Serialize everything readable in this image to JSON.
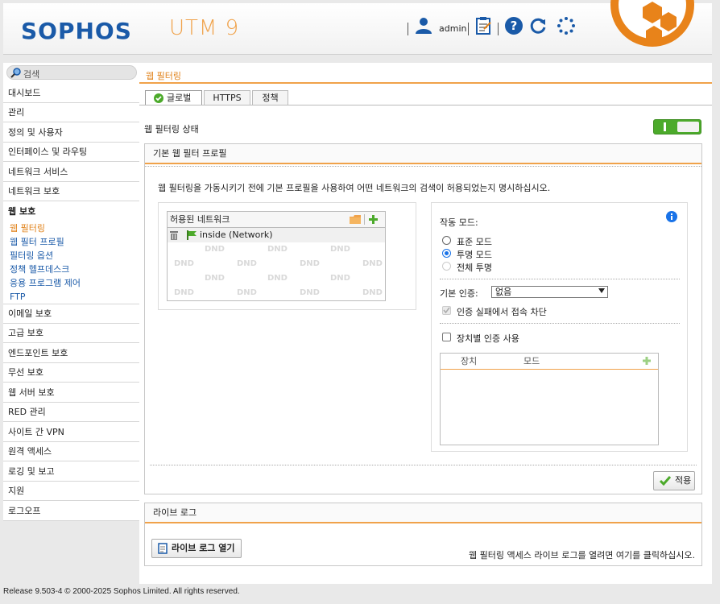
{
  "header": {
    "brand": "SOPHOS",
    "product": "UTM 9",
    "user": "admin"
  },
  "sidebar": {
    "search_placeholder": "검색",
    "items": [
      {
        "label": "대시보드"
      },
      {
        "label": "관리"
      },
      {
        "label": "정의 및 사용자"
      },
      {
        "label": "인터페이스 및 라우팅"
      },
      {
        "label": "네트워크 서비스"
      },
      {
        "label": "네트워크 보호"
      },
      {
        "label": "웹 보호"
      },
      {
        "label": "이메일 보호"
      },
      {
        "label": "고급 보호"
      },
      {
        "label": "엔드포인트 보호"
      },
      {
        "label": "무선 보호"
      },
      {
        "label": "웹 서버 보호"
      },
      {
        "label": "RED 관리"
      },
      {
        "label": "사이트 간 VPN"
      },
      {
        "label": "원격 액세스"
      },
      {
        "label": "로깅 및 보고"
      },
      {
        "label": "지원"
      },
      {
        "label": "로그오프"
      }
    ],
    "subitems": [
      {
        "label": "웹 필터링"
      },
      {
        "label": "웹 필터 프로필"
      },
      {
        "label": "필터링 옵션"
      },
      {
        "label": "정책 헬프데스크"
      },
      {
        "label": "응용 프로그램 제어"
      },
      {
        "label": "FTP"
      }
    ]
  },
  "main": {
    "title": "웹 필터링",
    "tabs": [
      {
        "label": "글로벌"
      },
      {
        "label": "HTTPS"
      },
      {
        "label": "정책"
      }
    ],
    "status_label": "웹 필터링 상태",
    "status_on": true,
    "profile_panel": {
      "title": "기본 웹 필터 프로필",
      "description": "웹 필터링을 가동시키기 전에 기본 프로필을 사용하여 어떤 네트워크의 검색이 허용되었는지 명시하십시오.",
      "allowed_networks": {
        "header": "허용된 네트워크",
        "items": [
          {
            "label": "inside (Network)"
          }
        ],
        "watermark": "DND"
      },
      "mode": {
        "label": "작동 모드:",
        "options": [
          {
            "label": "표준 모드",
            "checked": false,
            "disabled": false
          },
          {
            "label": "투명 모드",
            "checked": true,
            "disabled": false
          },
          {
            "label": "전체 투명",
            "checked": false,
            "disabled": true
          }
        ],
        "auth_label": "기본 인증:",
        "auth_value": "없음",
        "block_label": "인증 실패에서 접속 차단",
        "device_auth_label": "장치별 인증 사용",
        "device_table": {
          "columns": [
            "장치",
            "모드"
          ]
        }
      },
      "apply_label": "적용"
    },
    "live_log_panel": {
      "title": "라이브 로그",
      "button_label": "라이브 로그 열기",
      "description": "웹 필터링 액세스 라이브 로그를 열려면 여기를 클릭하십시오."
    }
  },
  "footer": {
    "text": "Release 9.503-4  © 2000-2025 Sophos Limited. All rights reserved."
  },
  "colors": {
    "accent": "#f0a24a",
    "brand": "#1a5aa8",
    "toggle_on": "#4caa2b"
  }
}
